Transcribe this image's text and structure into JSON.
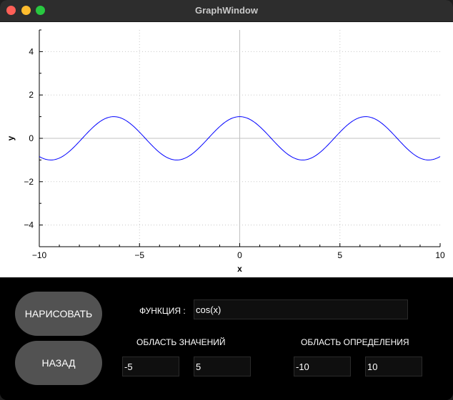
{
  "window": {
    "title": "GraphWindow"
  },
  "chart_data": {
    "type": "line",
    "function": "cos(x)",
    "xlabel": "x",
    "ylabel": "y",
    "xlim": [
      -10,
      10
    ],
    "ylim": [
      -5,
      5
    ],
    "x_ticks": [
      -10,
      -5,
      0,
      5,
      10
    ],
    "y_ticks": [
      -4,
      -2,
      0,
      2,
      4
    ],
    "grid": true,
    "line_color": "#0000ff",
    "series": [
      {
        "x_range": [
          -10,
          10
        ],
        "expr": "cos(x)"
      }
    ]
  },
  "controls": {
    "draw_label": "НАРИСОВАТЬ",
    "back_label": "НАЗАД",
    "function_label": "ФУНКЦИЯ :",
    "function_value": "cos(x)",
    "range_label": "ОБЛАСТЬ ЗНАЧЕНИЙ",
    "range_min": "-5",
    "range_max": "5",
    "domain_label": "ОБЛАСТЬ ОПРЕДЕЛЕНИЯ",
    "domain_min": "-10",
    "domain_max": "10"
  },
  "colors": {
    "button_bg": "#525252",
    "plot_bg": "#ffffff",
    "curve": "#0000ff"
  }
}
